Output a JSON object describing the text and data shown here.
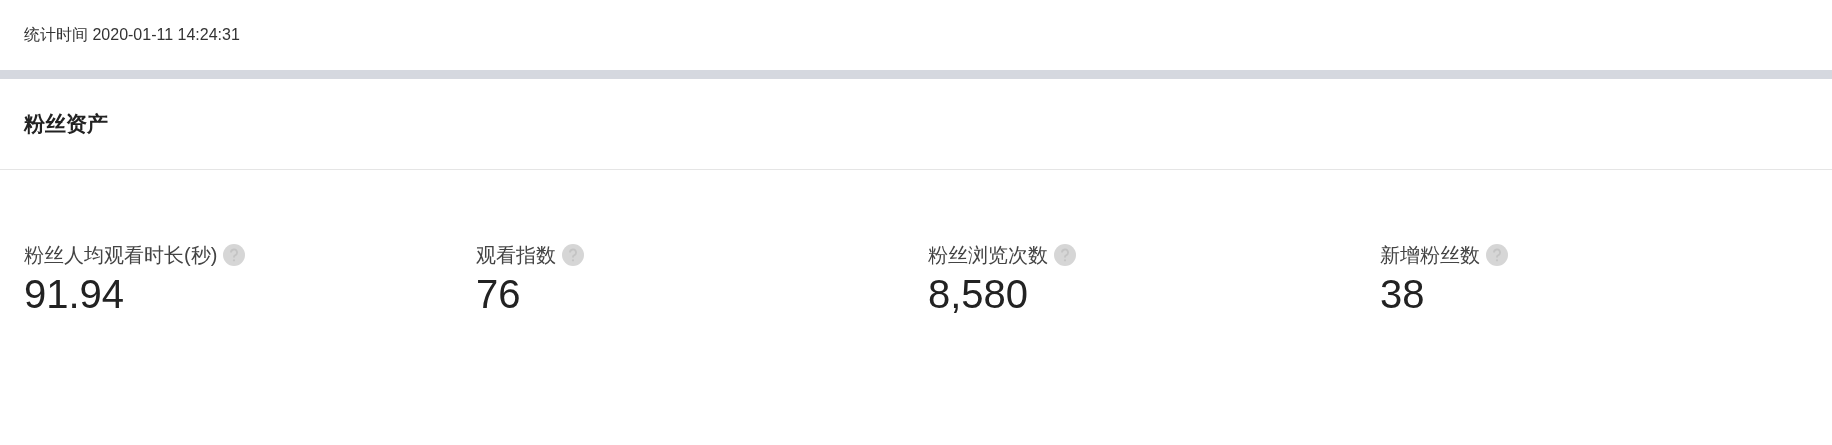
{
  "stat_time": "统计时间 2020-01-11 14:24:31",
  "section": {
    "title": "粉丝资产",
    "metrics": [
      {
        "label": "粉丝人均观看时长(秒)",
        "value": "91.94"
      },
      {
        "label": "观看指数",
        "value": "76"
      },
      {
        "label": "粉丝浏览次数",
        "value": "8,580"
      },
      {
        "label": "新增粉丝数",
        "value": "38"
      }
    ]
  }
}
